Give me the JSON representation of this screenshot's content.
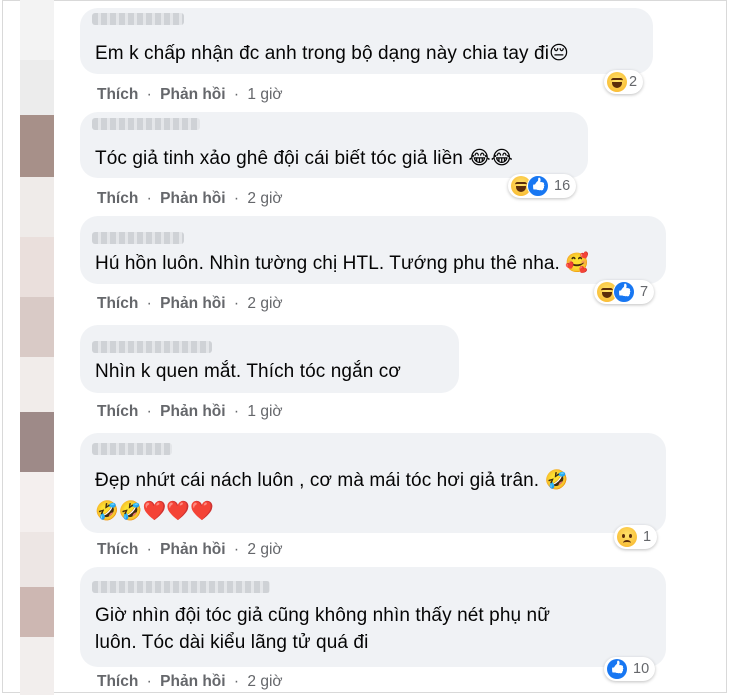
{
  "comments": [
    {
      "text": "Em k chấp nhận đc anh trong bộ dạng này chia tay đi😔",
      "like": "Thích",
      "reply": "Phản hồi",
      "time": "1 giờ",
      "reaction_count": "2",
      "reactions": [
        "haha-icon"
      ]
    },
    {
      "text": "Tóc giả tinh xảo ghê đội cái biết tóc giả liền 😂😂",
      "like": "Thích",
      "reply": "Phản hồi",
      "time": "2 giờ",
      "reaction_count": "16",
      "reactions": [
        "haha-icon",
        "like-icon"
      ]
    },
    {
      "text": "Hú hồn luôn. Nhìn tường chị HTL. Tướng phu thê nha. 🥰",
      "like": "Thích",
      "reply": "Phản hồi",
      "time": "2 giờ",
      "reaction_count": "7",
      "reactions": [
        "haha-icon",
        "like-icon"
      ]
    },
    {
      "text": "Nhìn k quen mắt. Thích tóc ngắn cơ",
      "like": "Thích",
      "reply": "Phản hồi",
      "time": "1 giờ"
    },
    {
      "text_line1": "Đẹp nhứt cái nách luôn , cơ mà mái tóc hơi giả trân. 🤣",
      "text_line2": "🤣🤣❤️❤️❤️",
      "like": "Thích",
      "reply": "Phản hồi",
      "time": "2 giờ",
      "reaction_count": "1",
      "reactions": [
        "sad-icon"
      ]
    },
    {
      "text_line1": "Giờ nhìn đội tóc giả cũng không nhìn thấy nét phụ nữ",
      "text_line2": "luôn. Tóc dài kiểu lãng tử quá đi",
      "like": "Thích",
      "reply": "Phản hồi",
      "time": "2 giờ",
      "reaction_count": "10",
      "reactions": [
        "like-icon"
      ]
    }
  ],
  "separator": "·",
  "colors": {
    "bubble": "#f0f2f5",
    "text": "#050505",
    "meta": "#65676b",
    "like_blue": "#1877f2"
  }
}
